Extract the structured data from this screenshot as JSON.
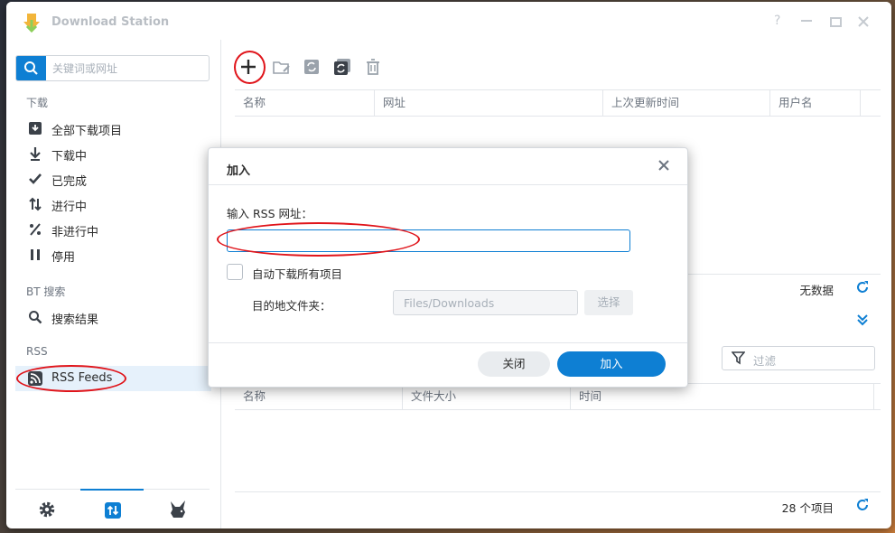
{
  "window": {
    "title": "Download Station",
    "help": "?"
  },
  "search": {
    "placeholder": "关键词或网址"
  },
  "sidebar": {
    "sections": [
      {
        "heading": "下载"
      },
      {
        "heading": "BT 搜索"
      },
      {
        "heading": "RSS"
      }
    ],
    "items": [
      {
        "label": "全部下载项目",
        "icon": "download-icon"
      },
      {
        "label": "下载中",
        "icon": "arrow-down-icon"
      },
      {
        "label": "已完成",
        "icon": "check-icon"
      },
      {
        "label": "进行中",
        "icon": "arrows-updown-icon"
      },
      {
        "label": "非进行中",
        "icon": "percent-icon"
      },
      {
        "label": "停用",
        "icon": "pause-icon"
      },
      {
        "label": "搜索结果",
        "icon": "search-icon"
      },
      {
        "label": "RSS Feeds",
        "icon": "rss-icon"
      }
    ]
  },
  "top_grid": {
    "columns": [
      "名称",
      "网址",
      "上次更新时间",
      "用户名"
    ],
    "footer": "无数据"
  },
  "bottom_grid": {
    "filter_placeholder": "过滤",
    "columns": [
      "名称",
      "文件大小",
      "时间"
    ],
    "footer": "28 个项目"
  },
  "dialog": {
    "title": "加入",
    "url_label": "输入 RSS 网址：",
    "url_value": "",
    "auto_download_label": "自动下载所有项目",
    "dest_label": "目的地文件夹：",
    "dest_value": "Files/Downloads",
    "choose_label": "选择",
    "close_label": "关闭",
    "add_label": "加入"
  },
  "colors": {
    "accent": "#0e7fd3",
    "annotation": "#e0151b"
  }
}
